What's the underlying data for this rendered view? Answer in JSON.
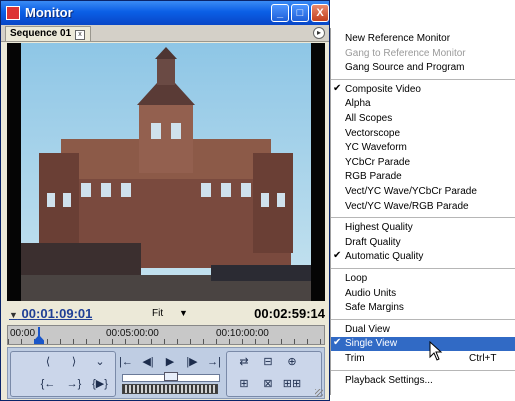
{
  "window": {
    "title": "Monitor",
    "buttons": {
      "minimize": "_",
      "maximize": "□",
      "close": "X"
    },
    "tab": {
      "label": "Sequence 01",
      "close_glyph": "x"
    },
    "panel_menu_glyph": "▸"
  },
  "viewer": {
    "current_timecode": "00:01:09:01",
    "zoom": "Fit",
    "duration_timecode": "00:02:59:14",
    "ruler_labels": [
      "00:00",
      "00:05:00:00",
      "00:10:00:00"
    ]
  },
  "controls": {
    "row1": [
      "⟨",
      "⟩",
      "⌄",
      "|←",
      "◀|",
      "▶",
      "|▶",
      "→|",
      "⇄",
      "⊟",
      "⊕"
    ],
    "row2": [
      "{←",
      "→}",
      "{▶}",
      "⊞",
      "⊠",
      "⊞⊞"
    ]
  },
  "menu": {
    "items": [
      {
        "label": "New Reference Monitor",
        "enabled": true,
        "checked": false
      },
      {
        "label": "Gang to Reference Monitor",
        "enabled": false,
        "checked": false
      },
      {
        "label": "Gang Source and Program",
        "enabled": true,
        "checked": false
      },
      {
        "separator": true
      },
      {
        "label": "Composite Video",
        "enabled": true,
        "checked": true
      },
      {
        "label": "Alpha",
        "enabled": true,
        "checked": false
      },
      {
        "label": "All Scopes",
        "enabled": true,
        "checked": false
      },
      {
        "label": "Vectorscope",
        "enabled": true,
        "checked": false
      },
      {
        "label": "YC Waveform",
        "enabled": true,
        "checked": false
      },
      {
        "label": "YCbCr Parade",
        "enabled": true,
        "checked": false
      },
      {
        "label": "RGB Parade",
        "enabled": true,
        "checked": false
      },
      {
        "label": "Vect/YC Wave/YCbCr Parade",
        "enabled": true,
        "checked": false
      },
      {
        "label": "Vect/YC Wave/RGB Parade",
        "enabled": true,
        "checked": false
      },
      {
        "separator": true
      },
      {
        "label": "Highest Quality",
        "enabled": true,
        "checked": false
      },
      {
        "label": "Draft Quality",
        "enabled": true,
        "checked": false
      },
      {
        "label": "Automatic Quality",
        "enabled": true,
        "checked": true
      },
      {
        "separator": true
      },
      {
        "label": "Loop",
        "enabled": true,
        "checked": false
      },
      {
        "label": "Audio Units",
        "enabled": true,
        "checked": false
      },
      {
        "label": "Safe Margins",
        "enabled": true,
        "checked": false
      },
      {
        "separator": true
      },
      {
        "label": "Dual View",
        "enabled": true,
        "checked": false
      },
      {
        "label": "Single View",
        "enabled": true,
        "checked": true,
        "highlighted": true
      },
      {
        "label": "Trim",
        "enabled": true,
        "checked": false,
        "shortcut": "Ctrl+T"
      },
      {
        "separator": true
      },
      {
        "label": "Playback Settings...",
        "enabled": true,
        "checked": false
      }
    ]
  }
}
